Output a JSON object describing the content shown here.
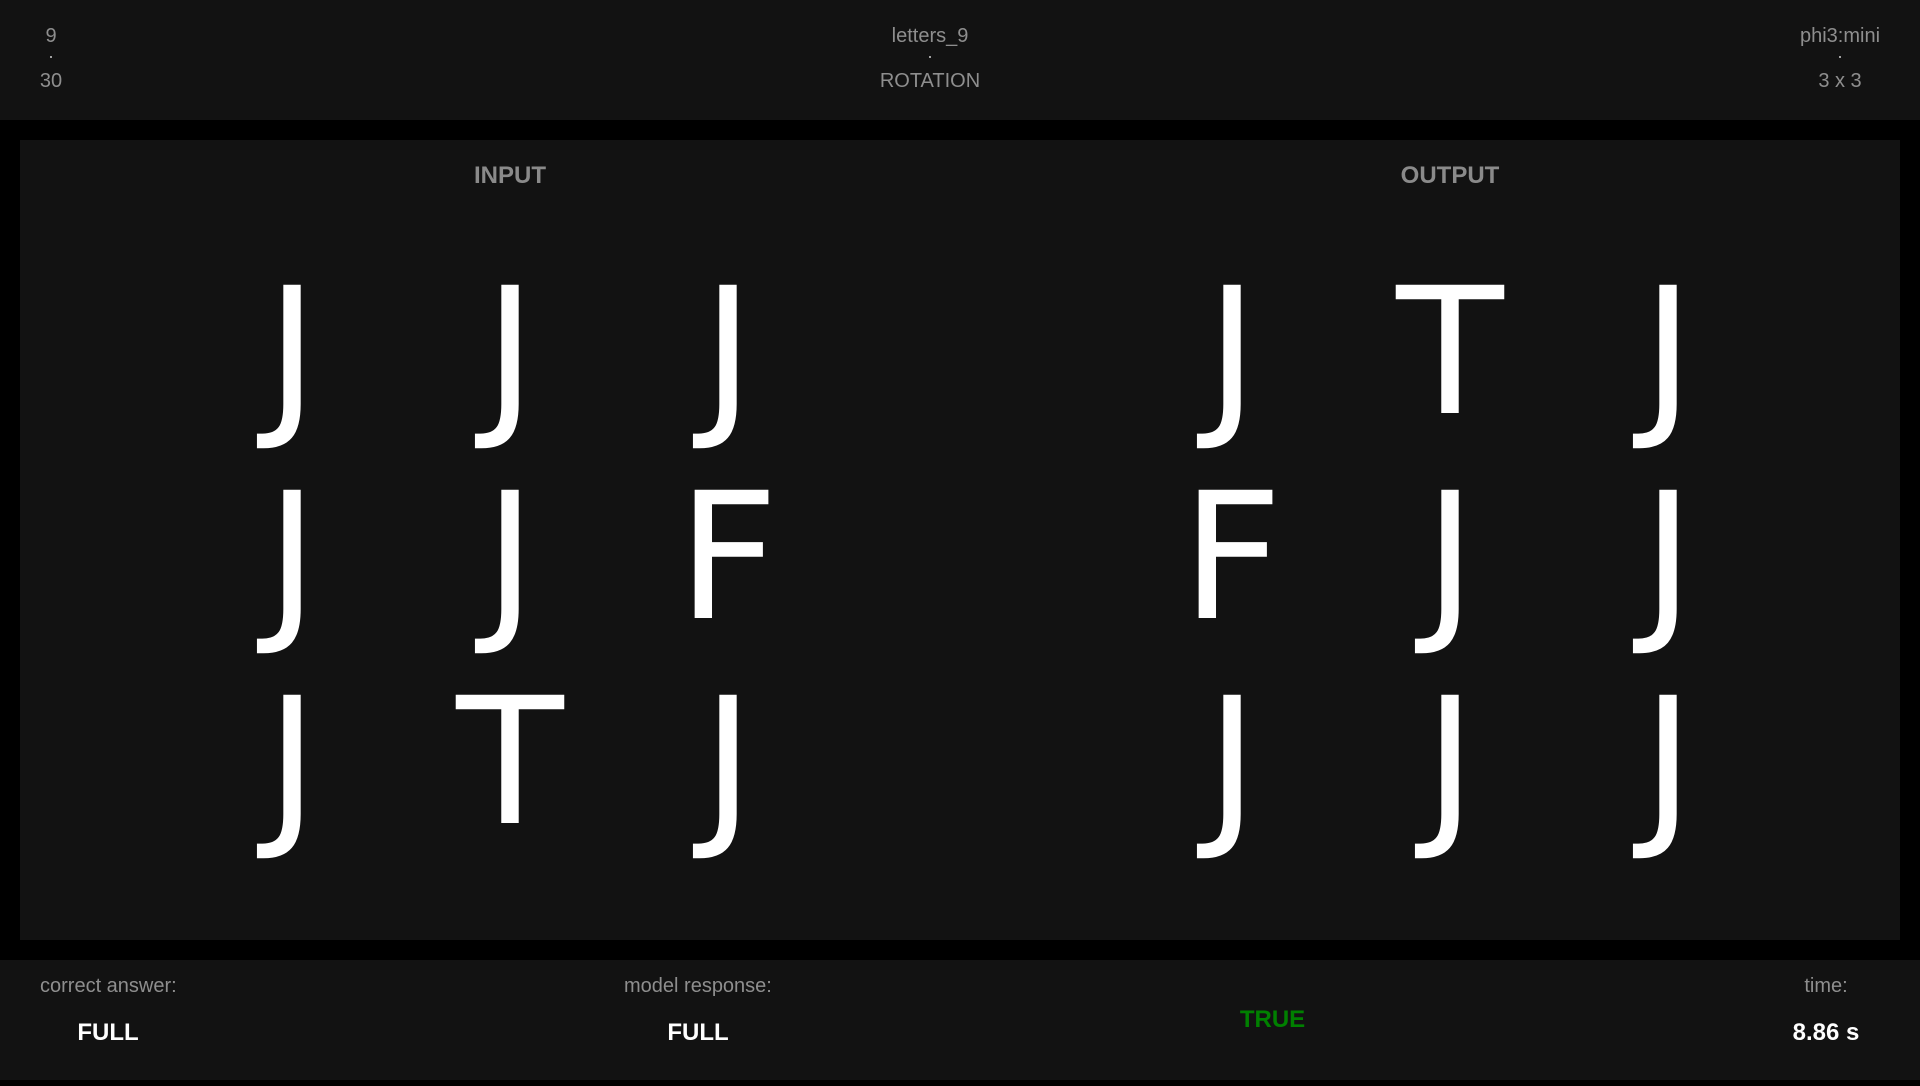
{
  "header": {
    "index": "9",
    "total": "30",
    "task_name": "letters_9",
    "task_type": "ROTATION",
    "model": "phi3:mini",
    "grid_size": "3 x 3"
  },
  "panel": {
    "input_title": "INPUT",
    "output_title": "OUTPUT",
    "input_grid": [
      [
        "J",
        "J",
        "J"
      ],
      [
        "J",
        "J",
        "F"
      ],
      [
        "J",
        "T",
        "J"
      ]
    ],
    "output_grid": [
      [
        "J",
        "T",
        "J"
      ],
      [
        "F",
        "J",
        "J"
      ],
      [
        "J",
        "J",
        "J"
      ]
    ]
  },
  "footer": {
    "correct_label": "correct answer:",
    "correct_value": "FULL",
    "model_label": "model response:",
    "model_value": "FULL",
    "verdict": "TRUE",
    "verdict_color": "#008000",
    "time_label": "time:",
    "time_value": "8.86 s"
  }
}
